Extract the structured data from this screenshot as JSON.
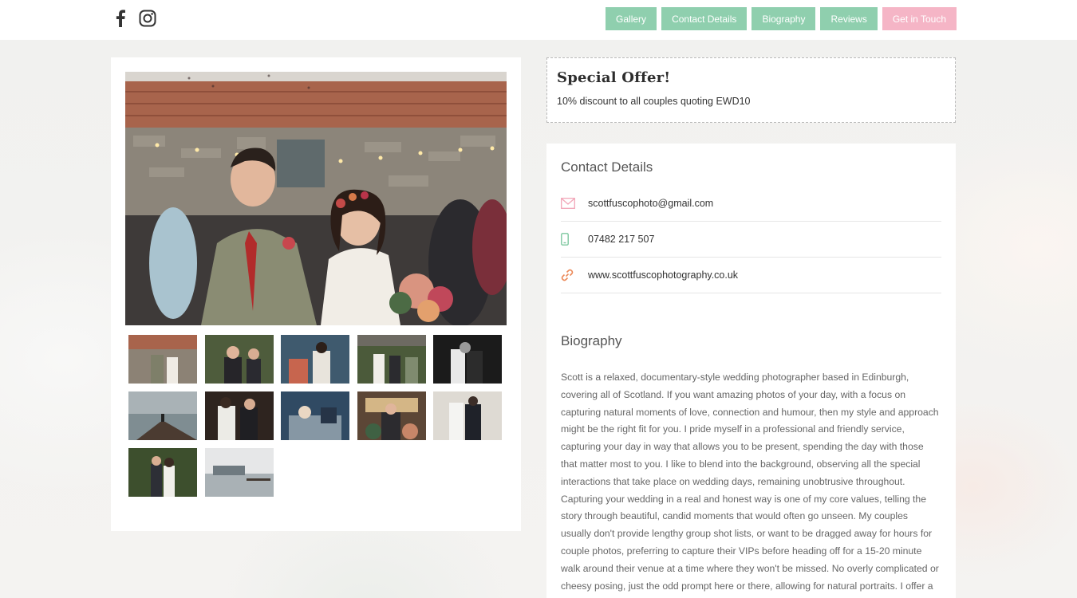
{
  "header": {
    "social": [
      {
        "icon": "facebook-icon"
      },
      {
        "icon": "instagram-icon"
      }
    ],
    "nav": [
      {
        "label": "Gallery",
        "color": "#8fcfae"
      },
      {
        "label": "Contact Details",
        "color": "#8fcfae"
      },
      {
        "label": "Biography",
        "color": "#8fcfae"
      },
      {
        "label": "Reviews",
        "color": "#8fcfae"
      },
      {
        "label": "Get in Touch",
        "color": "#f5b5c6"
      }
    ]
  },
  "gallery": {
    "main_photo": "couple-confetti-photo",
    "thumbnails": 12
  },
  "offer": {
    "title": "Special Offer!",
    "text": "10% discount to all couples quoting EWD10"
  },
  "contact": {
    "title": "Contact Details",
    "email": "scottfuscophoto@gmail.com",
    "phone": "07482 217 507",
    "website": "www.scottfuscophotography.co.uk"
  },
  "biography": {
    "title": "Biography",
    "text": "Scott is a relaxed, documentary-style wedding photographer based in Edinburgh, covering all of Scotland. If you want amazing photos of your day, with a focus on capturing natural moments of love, connection and humour, then my style and approach might be the right fit for you. I pride myself in a professional and friendly service, capturing your day in way that allows you to be present, spending the day with those that matter most to you. I like to blend into the background, observing all the special interactions that take place on wedding days, remaining unobtrusive throughout. Capturing your wedding in a real and honest way is one of my core values, telling the story through beautiful, candid moments that would often go unseen. My couples usually don't provide lengthy group shot lists, or want to be dragged away for hours for couple photos, preferring to capture their VIPs before heading off for a 15-20 minute walk around their venue at a time where they won't be missed. No overly complicated or cheesy posing, just the odd prompt here or there, allowing for natural portraits. I offer a"
  },
  "colors": {
    "accent_green": "#8fcfae",
    "accent_pink": "#f5b5c6",
    "icon_pink": "#f2a6b8",
    "icon_green": "#7cc79e",
    "icon_orange": "#ec8a5a"
  }
}
